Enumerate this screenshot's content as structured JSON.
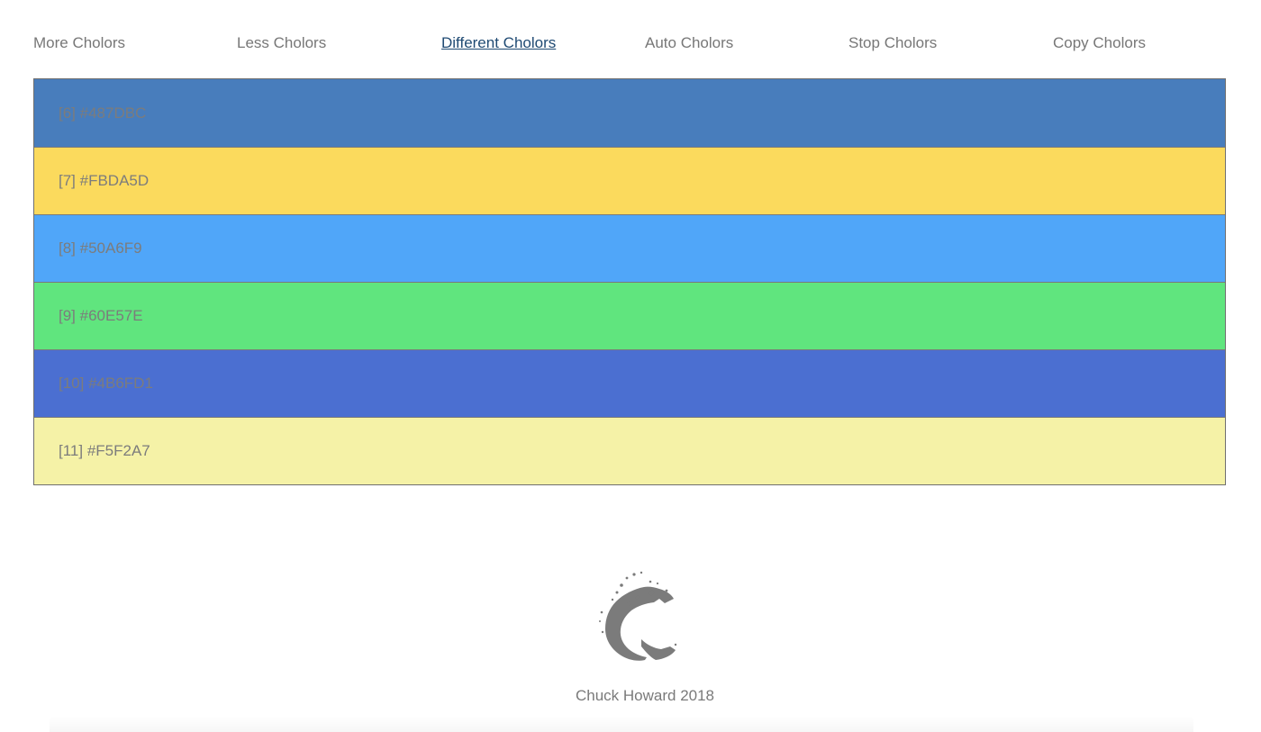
{
  "nav": {
    "items": [
      {
        "label": "More Cholors",
        "active": false
      },
      {
        "label": "Less Cholors",
        "active": false
      },
      {
        "label": "Different Cholors",
        "active": true
      },
      {
        "label": "Auto Cholors",
        "active": false
      },
      {
        "label": "Stop Cholors",
        "active": false
      },
      {
        "label": "Copy Cholors",
        "active": false
      }
    ]
  },
  "swatches": [
    {
      "label": "[6] #487DBC",
      "color": "#487DBC"
    },
    {
      "label": "[7] #FBDA5D",
      "color": "#FBDA5D"
    },
    {
      "label": "[8] #50A6F9",
      "color": "#50A6F9"
    },
    {
      "label": "[9] #60E57E",
      "color": "#60E57E"
    },
    {
      "label": "[10] #4B6FD1",
      "color": "#4B6FD1"
    },
    {
      "label": "[11] #F5F2A7",
      "color": "#F5F2A7"
    }
  ],
  "footer": {
    "logo_icon": "c-logo-icon",
    "credit": "Chuck Howard 2018"
  }
}
